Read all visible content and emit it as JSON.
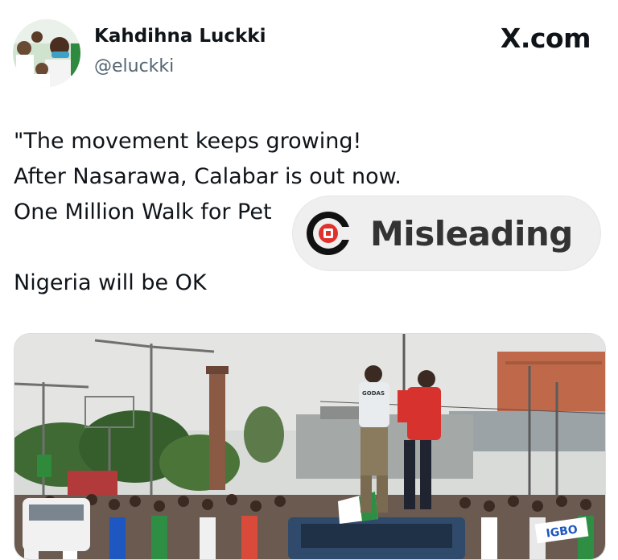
{
  "author": {
    "display_name": "Kahdihna Luckki",
    "handle": "@eluckki",
    "avatar_icon": "avatar-photo"
  },
  "brand": "X.com",
  "tweet": {
    "lines": [
      "\"The movement keeps growing!",
      "After Nasarawa, Calabar is out now.",
      "One Million Walk for Pet",
      "",
      "Nigeria will be OK"
    ]
  },
  "fact_check": {
    "verdict": "Misleading",
    "icon": "factcheck-logo-icon",
    "accent_color": "#e0312b"
  },
  "media": {
    "icon": "rally-photo",
    "shirt_text": "GODAS",
    "banner_text": "IGBO"
  },
  "colors": {
    "text": "#0f1419",
    "secondary": "#536471",
    "badge_bg": "#efefef"
  }
}
